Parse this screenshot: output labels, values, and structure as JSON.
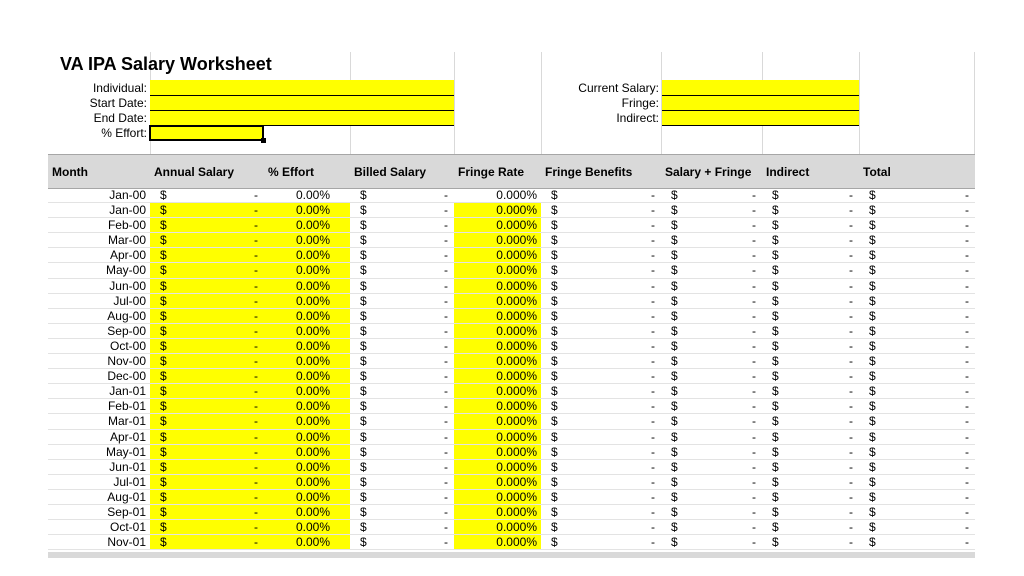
{
  "worksheet": {
    "title": "VA IPA Salary Worksheet",
    "fields_left": [
      {
        "label": "Individual:",
        "value": ""
      },
      {
        "label": "Start Date:",
        "value": ""
      },
      {
        "label": "End Date:",
        "value": ""
      },
      {
        "label": "% Effort:",
        "value": ""
      }
    ],
    "fields_right": [
      {
        "label": "Current Salary:",
        "value": ""
      },
      {
        "label": "Fringe:",
        "value": ""
      },
      {
        "label": "Indirect:",
        "value": ""
      }
    ],
    "highlight_color": "#ffff00",
    "header_color": "#d9d9d9"
  },
  "table": {
    "columns": [
      "Month",
      "Annual Salary",
      "% Effort",
      "Billed Salary",
      "Fringe Rate",
      "Fringe Benefits",
      "Salary + Fringe",
      "Indirect",
      "Total"
    ],
    "currency_symbol": "$",
    "empty_amount": "-",
    "rows": [
      {
        "month": "Jan-00",
        "effort": "0.00%",
        "fringe_rate": "0.000%",
        "highlight": false
      },
      {
        "month": "Jan-00",
        "effort": "0.00%",
        "fringe_rate": "0.000%",
        "highlight": true
      },
      {
        "month": "Feb-00",
        "effort": "0.00%",
        "fringe_rate": "0.000%",
        "highlight": true
      },
      {
        "month": "Mar-00",
        "effort": "0.00%",
        "fringe_rate": "0.000%",
        "highlight": true
      },
      {
        "month": "Apr-00",
        "effort": "0.00%",
        "fringe_rate": "0.000%",
        "highlight": true
      },
      {
        "month": "May-00",
        "effort": "0.00%",
        "fringe_rate": "0.000%",
        "highlight": true
      },
      {
        "month": "Jun-00",
        "effort": "0.00%",
        "fringe_rate": "0.000%",
        "highlight": true
      },
      {
        "month": "Jul-00",
        "effort": "0.00%",
        "fringe_rate": "0.000%",
        "highlight": true
      },
      {
        "month": "Aug-00",
        "effort": "0.00%",
        "fringe_rate": "0.000%",
        "highlight": true
      },
      {
        "month": "Sep-00",
        "effort": "0.00%",
        "fringe_rate": "0.000%",
        "highlight": true
      },
      {
        "month": "Oct-00",
        "effort": "0.00%",
        "fringe_rate": "0.000%",
        "highlight": true
      },
      {
        "month": "Nov-00",
        "effort": "0.00%",
        "fringe_rate": "0.000%",
        "highlight": true
      },
      {
        "month": "Dec-00",
        "effort": "0.00%",
        "fringe_rate": "0.000%",
        "highlight": true
      },
      {
        "month": "Jan-01",
        "effort": "0.00%",
        "fringe_rate": "0.000%",
        "highlight": true
      },
      {
        "month": "Feb-01",
        "effort": "0.00%",
        "fringe_rate": "0.000%",
        "highlight": true
      },
      {
        "month": "Mar-01",
        "effort": "0.00%",
        "fringe_rate": "0.000%",
        "highlight": true
      },
      {
        "month": "Apr-01",
        "effort": "0.00%",
        "fringe_rate": "0.000%",
        "highlight": true
      },
      {
        "month": "May-01",
        "effort": "0.00%",
        "fringe_rate": "0.000%",
        "highlight": true
      },
      {
        "month": "Jun-01",
        "effort": "0.00%",
        "fringe_rate": "0.000%",
        "highlight": true
      },
      {
        "month": "Jul-01",
        "effort": "0.00%",
        "fringe_rate": "0.000%",
        "highlight": true
      },
      {
        "month": "Aug-01",
        "effort": "0.00%",
        "fringe_rate": "0.000%",
        "highlight": true
      },
      {
        "month": "Sep-01",
        "effort": "0.00%",
        "fringe_rate": "0.000%",
        "highlight": true
      },
      {
        "month": "Oct-01",
        "effort": "0.00%",
        "fringe_rate": "0.000%",
        "highlight": true
      },
      {
        "month": "Nov-01",
        "effort": "0.00%",
        "fringe_rate": "0.000%",
        "highlight": true
      }
    ]
  }
}
